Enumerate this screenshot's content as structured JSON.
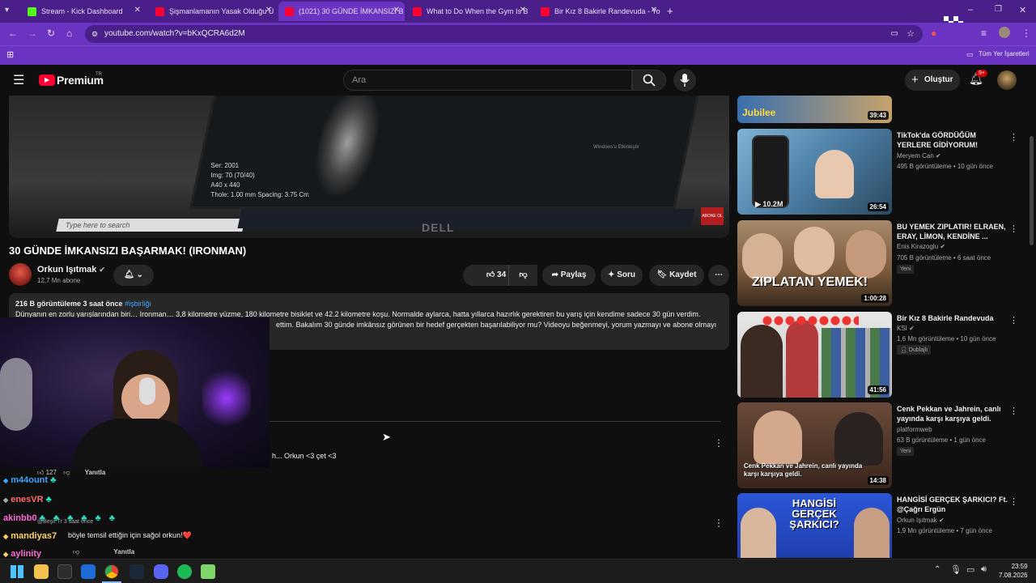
{
  "tabs": [
    {
      "label": "Stream - Kick Dashboard",
      "color": "#53fc18"
    },
    {
      "label": "Şişmanlamanın Yasak Olduğu Ü",
      "color": "#ff0033"
    },
    {
      "label": "(1021) 30 GÜNDE İMKANSIZI B",
      "color": "#ff0033"
    },
    {
      "label": "What to Do When the Gym Is B",
      "color": "#ff0033"
    },
    {
      "label": "Bir Kız 8 Bakirle Randevuda - Yo",
      "color": "#ff0033"
    }
  ],
  "browser": {
    "url": "youtube.com/watch?v=bKxQCRA6d2M",
    "bookmarks_label": "Tüm Yer İşaretleri"
  },
  "header": {
    "logo": "Premium",
    "logo_region": "TR",
    "search_placeholder": "Ara",
    "create_label": "Oluştur",
    "notif_count": "9+"
  },
  "video": {
    "screen_text": [
      "Ser: 2001",
      "Img: 70 (70/40)",
      "A40 x 440",
      "Thole: 1.00 mm Spacing: 3.75 Cm"
    ],
    "search_text": "Type here to search",
    "brand": "DELL",
    "windows_text": "Windows'u Etkinleştir",
    "sticker": "ABONE OL"
  },
  "main": {
    "title": "30 GÜNDE İMKANSIZI BAŞARMAK! (IRONMAN)",
    "channel": "Orkun Işıtmak",
    "subscribers": "12,7 Mn abone",
    "likes": "34 B",
    "share": "Paylaş",
    "ask": "Soru",
    "save": "Kaydet",
    "views_time": "216 B görüntüleme  3 saat önce",
    "hashtag": "#işbirliği",
    "desc_line1": "Dünyanın en zorlu yarışlarından biri… Ironman… 3,8 kilometre yüzme, 180 kilometre bisiklet ve 42.2 kilometre koşu. Normalde aylarca, hatta yıllarca hazırlık gerektiren bu yarış için kendime sadece 30 gün verdim.",
    "desc_line2": "ettim. Bakalım 30 günde imkânsız görünen bir hedef gerçekten başarılabiliyor mu? Videoyu beğenmeyi, yorum yazmayı ve abone olmayı"
  },
  "comments": {
    "c1_text": "h... Orkun <3 çet <3",
    "c1_likes": "127",
    "reply": "Yanıtla",
    "c2_author": "@Beşir.Tr",
    "c2_time": "3 saat önce",
    "c2_text": "böyle temsil ettiğin için sağol orkun!❤️"
  },
  "chat": [
    {
      "name": "m44ount",
      "color": "#3ea6ff"
    },
    {
      "name": "enesVR",
      "color": "#ff6b6b"
    },
    {
      "name": "akinbb0",
      "color": "#ff6ad5"
    },
    {
      "name": "mandiyas7",
      "color": "#ffd166"
    },
    {
      "name": "aylinity",
      "color": "#ff6ad5"
    }
  ],
  "recommendations": [
    {
      "title": "",
      "channel": "",
      "meta": "",
      "duration": "39:43",
      "thumb_color": "#3a6fb0",
      "thumb_text": "Jubilee"
    },
    {
      "title": "TikTok'da GÖRDÜĞÜM YERLERE GİDİYORUM!",
      "channel": "Meryem Can",
      "meta": "495 B görüntüleme • 10 gün önce",
      "duration": "26:54",
      "thumb_color": "#4d7fa6",
      "thumb_text": "▶ 10.2M"
    },
    {
      "title": "BU YEMEK ZIPLATIR! ELRAEN, ERAY, LİMON, KENDİNE ...",
      "channel": "Enis Kirazoglu",
      "meta": "705 B görüntüleme • 6 saat önce",
      "badge": "Yeni",
      "duration": "1:00:28",
      "thumb_color": "#7a5a3c",
      "thumb_text": "ZIPLATAN YEMEK!"
    },
    {
      "title": "Bir Kız 8 Bakirle Randevuda",
      "channel": "KSI",
      "meta": "1,6 Mn görüntüleme • 10 gün önce",
      "badge": "Dublajlı",
      "duration": "41:56",
      "thumb_color": "#c9c9c9",
      "thumb_text": ""
    },
    {
      "title": "Cenk Pekkan ve Jahrein, canlı yayında karşı karşıya geldi.",
      "channel": "platformweb",
      "meta": "63 B görüntüleme • 1 gün önce",
      "badge": "Yeni",
      "duration": "14:38",
      "thumb_color": "#5a3a2a",
      "thumb_text": "Cenk Pekkan ve Jahrein, canlı yayında karşı karşıya geldi."
    },
    {
      "title": "HANGİSİ GERÇEK ŞARKICI? Ft. @Çağrı Ergün",
      "channel": "Orkun Işıtmak",
      "meta": "1,9 Mn görüntüleme • 7 gün önce",
      "duration": "",
      "thumb_color": "#1f3fae",
      "thumb_text": "HANGİSİ GERÇEK ŞARKICI?"
    }
  ],
  "taskbar": {
    "time": "23:59",
    "date": "7.08.2026"
  }
}
